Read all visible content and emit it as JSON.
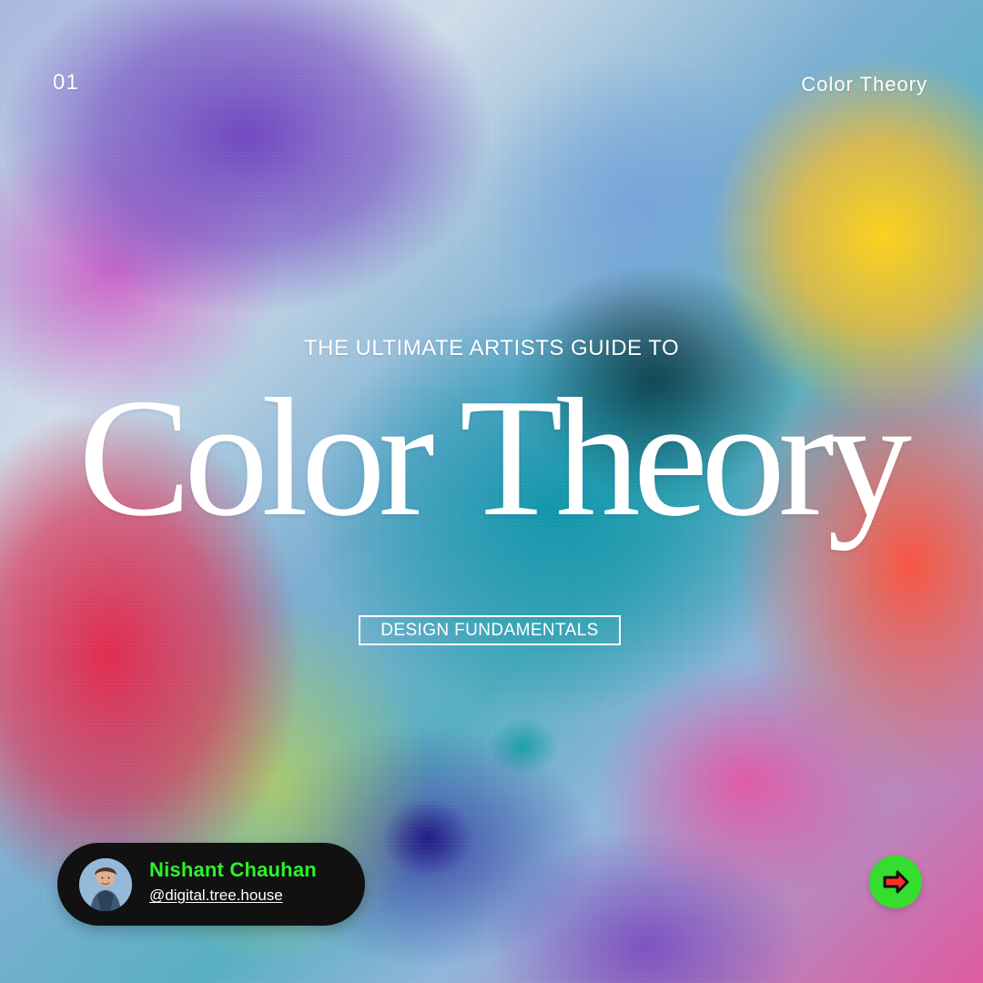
{
  "slide": {
    "number": "01",
    "series_label": "Color Theory"
  },
  "hero": {
    "eyebrow": "THE ULTIMATE ARTISTS GUIDE TO",
    "title": "Color Theory",
    "category": "DESIGN FUNDAMENTALS"
  },
  "profile": {
    "name": "Nishant Chauhan",
    "handle": "@digital.tree.house",
    "avatar_icon": "avatar-photo"
  },
  "navigation": {
    "next_icon": "arrow-right-icon"
  },
  "colors": {
    "profile_name": "#2df22b",
    "next_button": "#34dd2e",
    "card_background": "#111111",
    "text": "#ffffff"
  }
}
